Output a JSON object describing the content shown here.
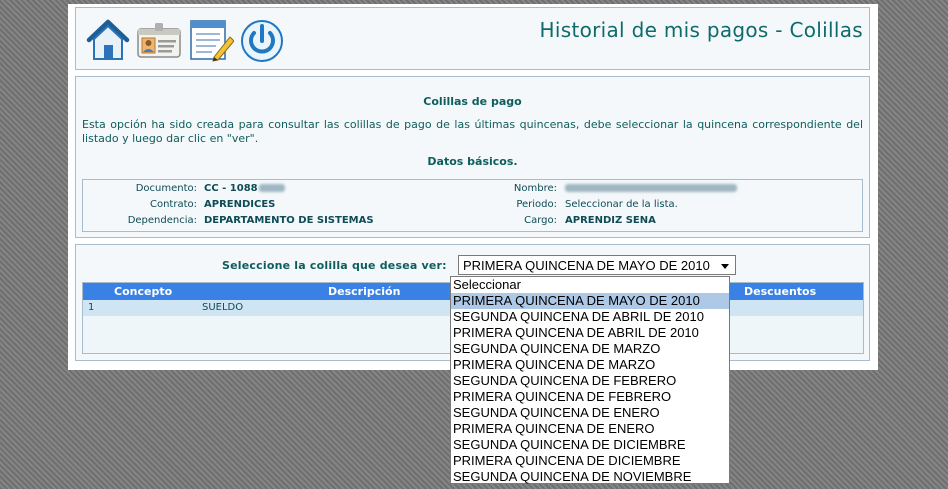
{
  "header": {
    "title": "Historial de mis pagos - Colillas",
    "icons": [
      "home-icon",
      "id-card-icon",
      "notepad-pencil-icon",
      "power-icon"
    ]
  },
  "info": {
    "heading": "Colillas de pago",
    "intro": "Esta opción ha sido creada para consultar las colillas de pago de las últimas quincenas, debe seleccionar la quincena correspondiente del listado y luego dar clic en \"ver\".",
    "datos_heading": "Datos básicos.",
    "documento_label": "Documento:",
    "documento_value": "CC - 1088",
    "nombre_label": "Nombre:",
    "contrato_label": "Contrato:",
    "contrato_value": "APRENDICES",
    "periodo_label": "Periodo:",
    "periodo_value": "Seleccionar de la lista.",
    "dependencia_label": "Dependencia:",
    "dependencia_value": "DEPARTAMENTO DE SISTEMAS",
    "cargo_label": "Cargo:",
    "cargo_value": "APRENDIZ SENA"
  },
  "selector": {
    "label": "Seleccione la colilla que desea ver:",
    "selected": "PRIMERA QUINCENA DE MAYO DE 2010",
    "options": [
      "Seleccionar",
      "PRIMERA QUINCENA DE MAYO DE 2010",
      "SEGUNDA QUINCENA DE ABRIL DE 2010",
      "PRIMERA QUINCENA DE ABRIL DE 2010",
      "SEGUNDA QUINCENA DE MARZO",
      "PRIMERA QUINCENA DE MARZO",
      "SEGUNDA QUINCENA DE FEBRERO",
      "PRIMERA QUINCENA DE FEBRERO",
      "SEGUNDA QUINCENA DE ENERO",
      "PRIMERA QUINCENA DE ENERO",
      "SEGUNDA QUINCENA DE DICIEMBRE",
      "PRIMERA QUINCENA DE DICIEMBRE",
      "SEGUNDA QUINCENA DE NOVIEMBRE"
    ],
    "highlighted_index": 1
  },
  "table": {
    "columns": [
      "Concepto",
      "Descripción",
      "Descuentos"
    ],
    "rows": [
      {
        "concepto": "1",
        "descripcion": "SUELDO"
      }
    ]
  },
  "colors": {
    "accent_teal": "#0f6b6b",
    "table_header_blue": "#3a81e5",
    "row_highlight": "#cfe5f3",
    "option_highlight": "#aec9e7"
  }
}
